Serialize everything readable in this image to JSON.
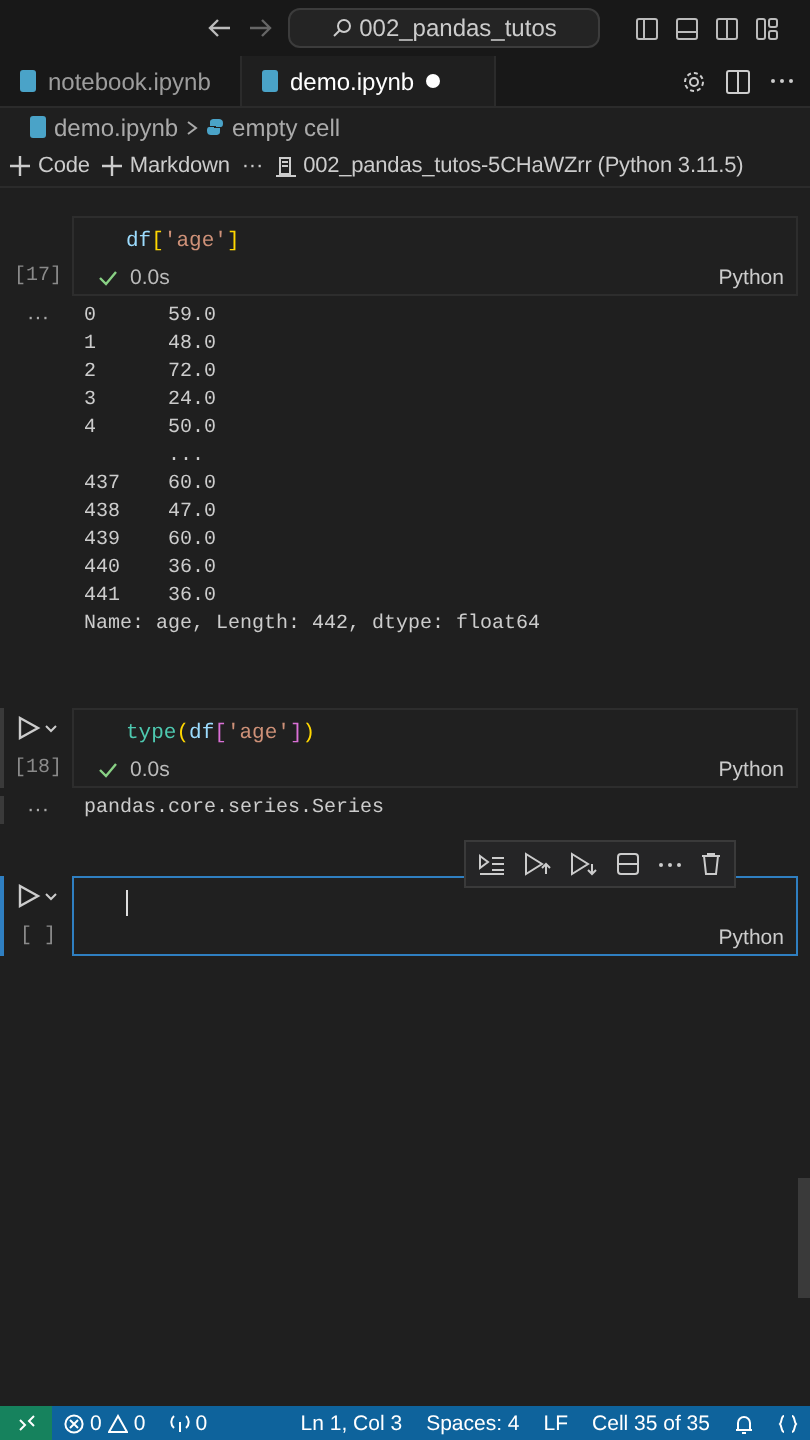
{
  "title_bar": {
    "search": "002_pandas_tutos"
  },
  "tabs": [
    {
      "label": "notebook.ipynb",
      "selected": false,
      "modified": false
    },
    {
      "label": "demo.ipynb",
      "selected": true,
      "modified": true
    }
  ],
  "breadcrumb": [
    "demo.ipynb",
    "empty cell"
  ],
  "toolbar": {
    "add_code": "Code",
    "add_markdown": "Markdown",
    "more": "···",
    "kernel": "002_pandas_tutos-5CHaWZrr (Python 3.11.5)"
  },
  "cells": [
    {
      "focused": false,
      "hovered": false,
      "exec_count": "[17]",
      "code": [
        {
          "kind": "var",
          "text": "df"
        },
        {
          "kind": "bracket",
          "text": "["
        },
        {
          "kind": "string",
          "text": "'age'"
        },
        {
          "kind": "bracket",
          "text": "]"
        }
      ],
      "time": "0.0s",
      "language": "Python",
      "output": {
        "more": "···",
        "lines": [
          "0      59.0",
          "1      48.0",
          "2      72.0",
          "3      24.0",
          "4      50.0",
          "       ...",
          "437    60.0",
          "438    47.0",
          "439    60.0",
          "440    36.0",
          "441    36.0",
          "Name: age, Length: 442, dtype: float64"
        ]
      }
    },
    {
      "focused": false,
      "hovered": true,
      "exec_count": "[18]",
      "code": [
        {
          "kind": "fn",
          "text": "type"
        },
        {
          "kind": "bracket",
          "text": "("
        },
        {
          "kind": "var",
          "text": "df"
        },
        {
          "kind": "bracket2",
          "text": "["
        },
        {
          "kind": "string",
          "text": "'age'"
        },
        {
          "kind": "bracket2",
          "text": "]"
        },
        {
          "kind": "bracket",
          "text": ")"
        }
      ],
      "time": "0.0s",
      "language": "Python",
      "output": {
        "more": "···",
        "lines": [
          "pandas.core.series.Series"
        ]
      }
    },
    {
      "focused": true,
      "exec_count": "[ ]",
      "language": "Python"
    }
  ],
  "status_bar": {
    "errors": "0",
    "warnings": "0",
    "ports": "0",
    "position": "Ln 1, Col 3",
    "spaces": "Spaces: 4",
    "eol": "LF",
    "cell": "Cell 35 of 35"
  }
}
